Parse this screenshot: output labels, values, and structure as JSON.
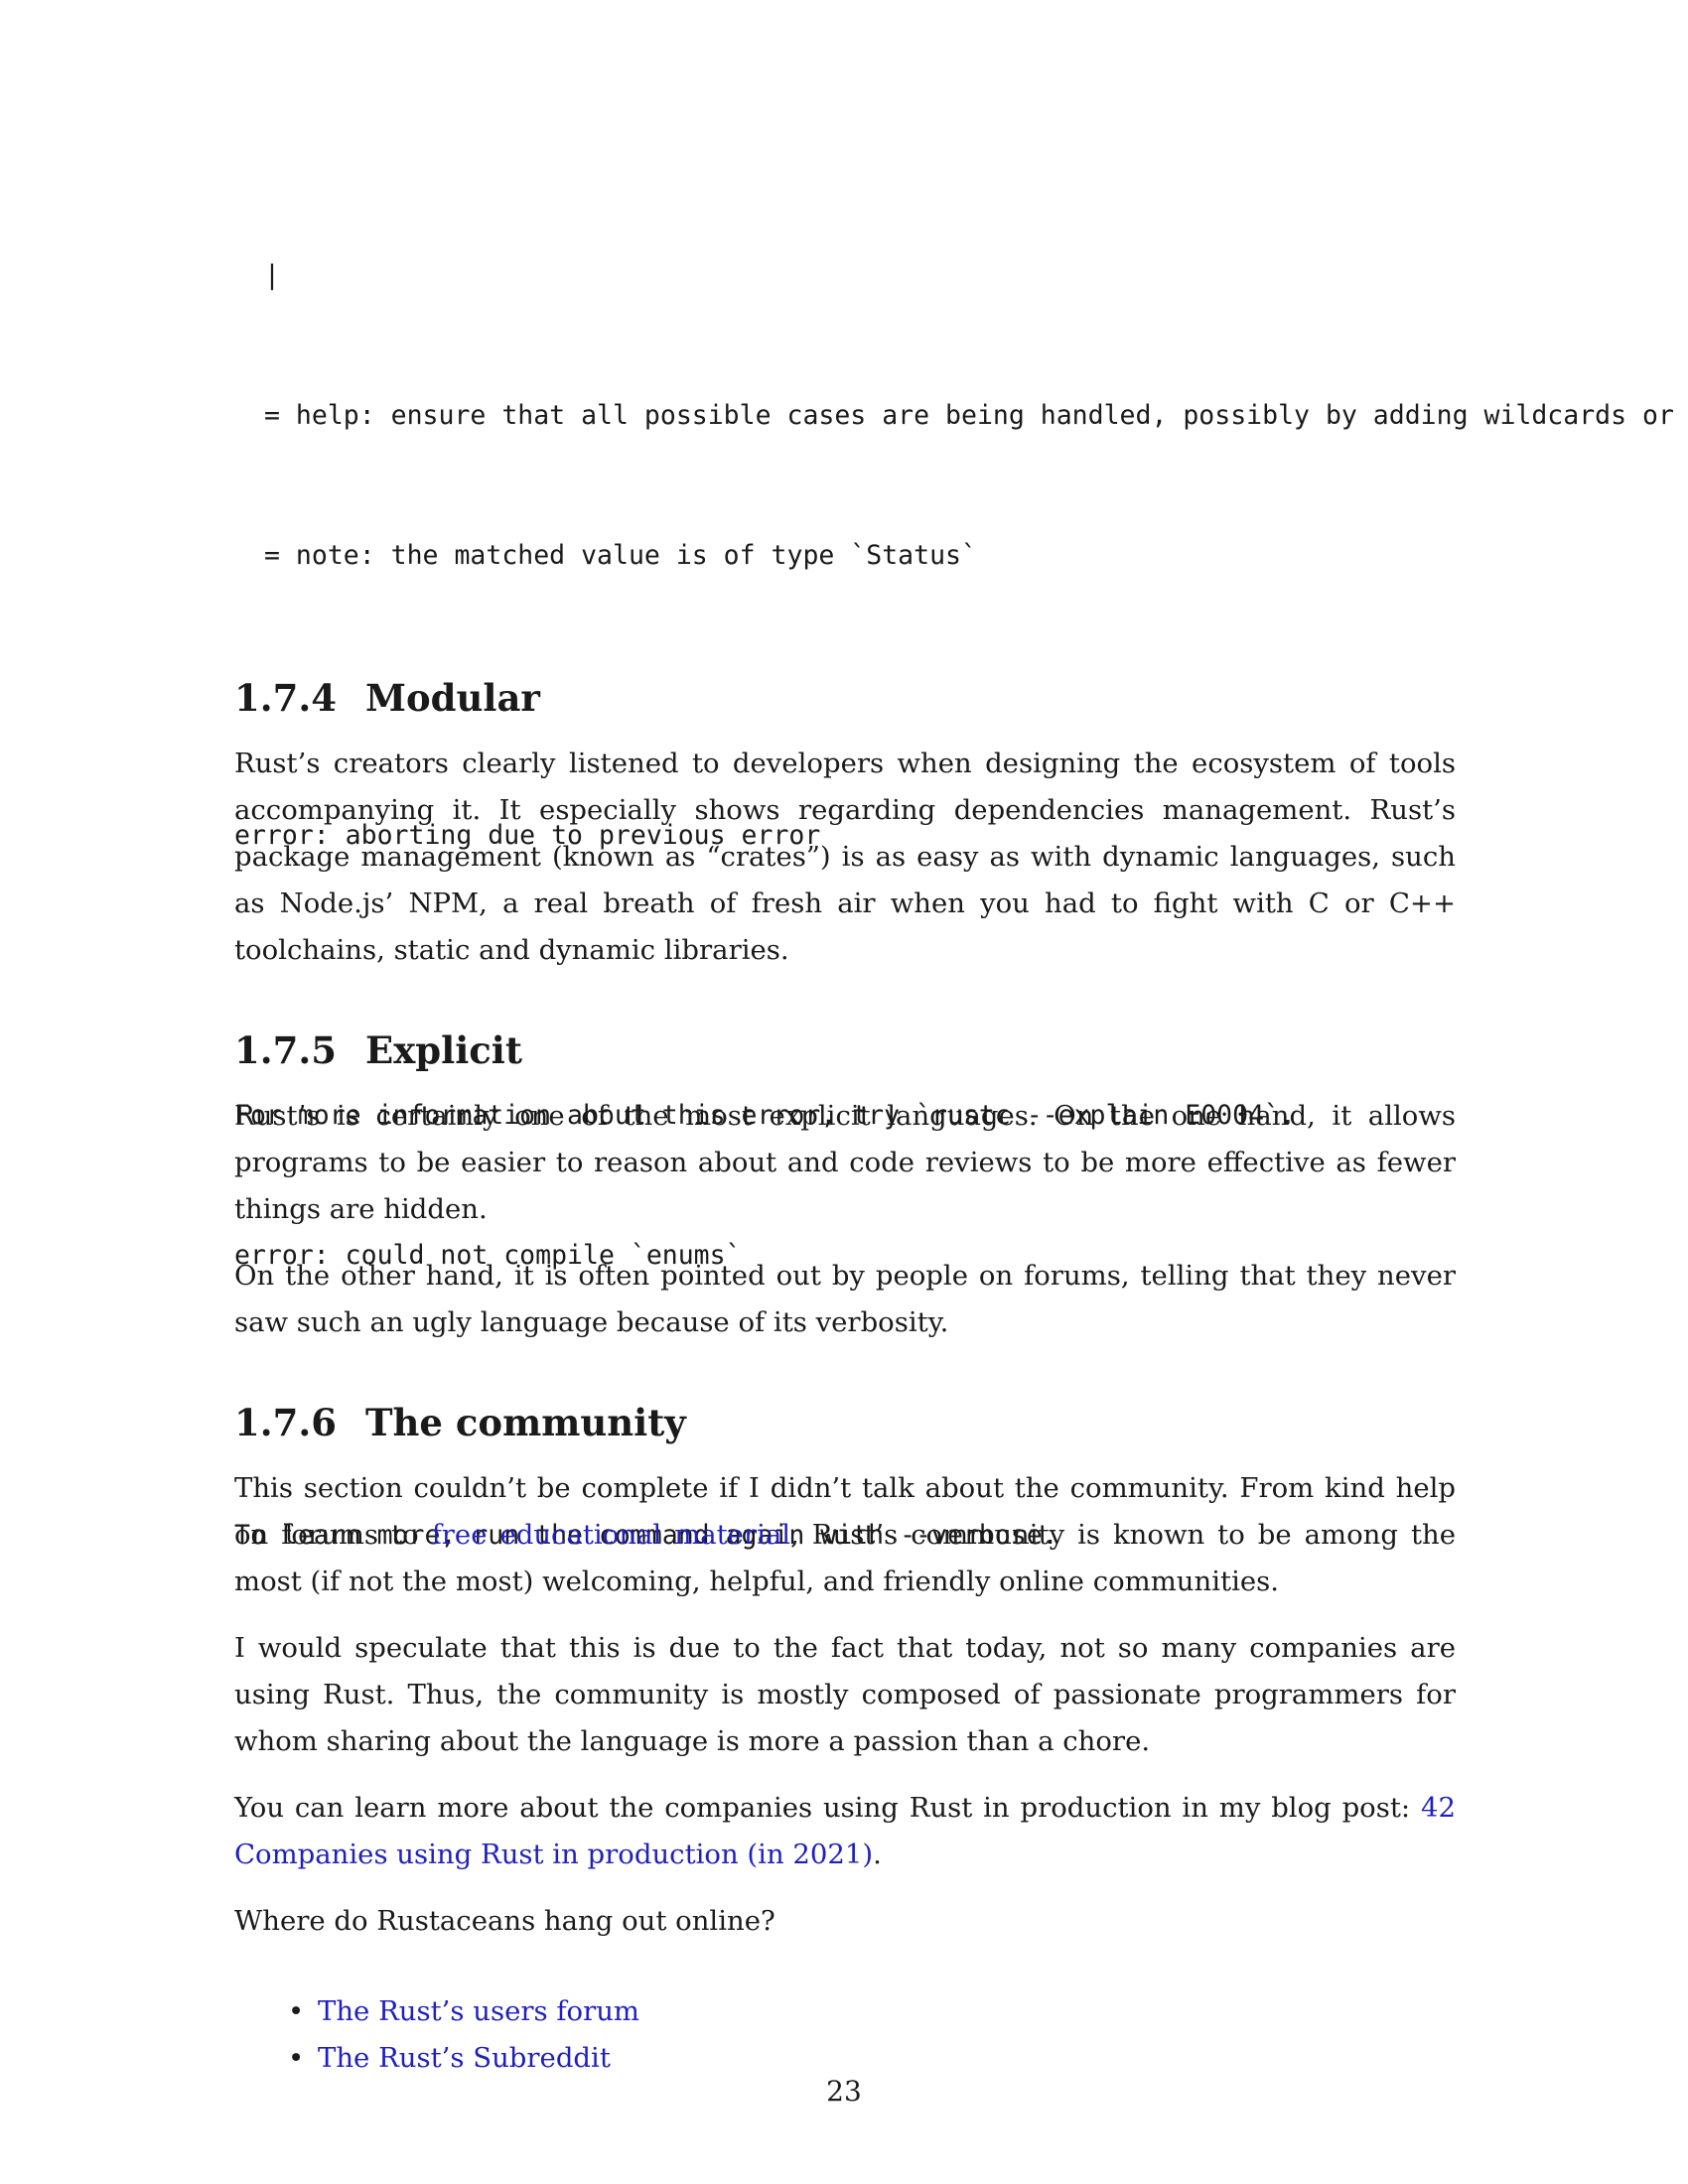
{
  "code_block": {
    "lines": [
      "|",
      "= help: ensure that all possible cases are being handled, possibly by adding wildcards or more match arms",
      "= note: the matched value is of type `Status`",
      "",
      "error: aborting due to previous error",
      "",
      "For more information about this error, try `rustc --explain E0004`.",
      "error: could not compile `enums`",
      "",
      "To learn more, run the command again with --verbose."
    ]
  },
  "sections": {
    "modular": {
      "number": "1.7.4",
      "title": "Modular",
      "p1": "Rust’s creators clearly listened to developers when designing the ecosystem of tools accompanying it. It especially shows regarding dependencies management. Rust’s package management (known as “crates”) is as easy as with dynamic languages, such as Node.js’ NPM, a real breath of fresh air when you had to fight with C or C++ toolchains, static and dynamic libraries."
    },
    "explicit": {
      "number": "1.7.5",
      "title": "Explicit",
      "p1": "Rust’s is certainly one of the most explicit languages. On the one hand, it allows programs to be easier to reason about and code reviews to be more effective as fewer things are hidden.",
      "p2": "On the other hand, it is often pointed out by people on forums, telling that they never saw such an ugly language because of its verbosity."
    },
    "community": {
      "number": "1.7.6",
      "title": "The community",
      "p1_before": "This section couldn’t be complete if I didn’t talk about the community. From kind help on forums to ",
      "p1_link": "free educational material",
      "p1_after": ", Rust’s community is known to be among the most (if not the most) welcoming, helpful, and friendly online communities.",
      "p2": "I would speculate that this is due to the fact that today, not so many companies are using Rust. Thus, the community is mostly composed of passionate programmers for whom sharing about the language is more a passion than a chore.",
      "p3_before": "You can learn more about the companies using Rust in production in my blog post: ",
      "p3_link": "42 Companies using Rust in production (in 2021)",
      "p3_after": ".",
      "p4": "Where do Rustaceans hang out online?",
      "bullet": "•",
      "links": [
        "The Rust’s users forum",
        "The Rust’s Subreddit"
      ]
    }
  },
  "page_number": "23"
}
